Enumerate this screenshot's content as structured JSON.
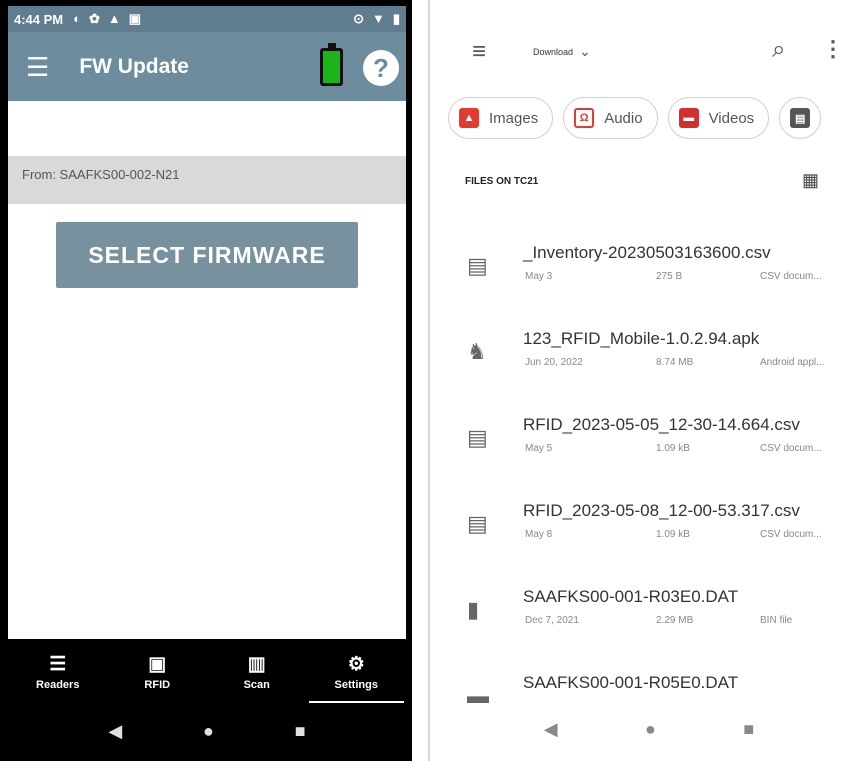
{
  "left": {
    "status": {
      "time": "4:44 PM"
    },
    "appbar": {
      "title": "FW Update"
    },
    "from_text": "From: SAAFKS00-002-N21",
    "select_button": "SELECT FIRMWARE",
    "nav": [
      {
        "label": "Readers",
        "icon": "list-icon"
      },
      {
        "label": "RFID",
        "icon": "rfid-icon"
      },
      {
        "label": "Scan",
        "icon": "barcode-icon"
      },
      {
        "label": "Settings",
        "icon": "gear-icon"
      }
    ]
  },
  "right": {
    "location": "Download",
    "chips": [
      {
        "label": "Images",
        "icon": "image-icon"
      },
      {
        "label": "Audio",
        "icon": "audio-icon"
      },
      {
        "label": "Videos",
        "icon": "video-icon"
      },
      {
        "label": "",
        "icon": "document-icon"
      }
    ],
    "section_header": "FILES ON TC21",
    "files": [
      {
        "name": "_Inventory-20230503163600.csv",
        "date": "May 3",
        "size": "275 B",
        "type": "CSV docum...",
        "icon": "document-icon"
      },
      {
        "name": "123_RFID_Mobile-1.0.2.94.apk",
        "date": "Jun 20, 2022",
        "size": "8.74 MB",
        "type": "Android appl...",
        "icon": "android-icon"
      },
      {
        "name": "RFID_2023-05-05_12-30-14.664.csv",
        "date": "May 5",
        "size": "1.09 kB",
        "type": "CSV docum...",
        "icon": "document-icon"
      },
      {
        "name": "RFID_2023-05-08_12-00-53.317.csv",
        "date": "May 8",
        "size": "1.09 kB",
        "type": "CSV docum...",
        "icon": "document-icon"
      },
      {
        "name": "SAAFKS00-001-R03E0.DAT",
        "date": "Dec 7, 2021",
        "size": "2.29 MB",
        "type": "BIN file",
        "icon": "file-icon"
      },
      {
        "name": "SAAFKS00-001-R05E0.DAT",
        "date": "",
        "size": "",
        "type": "",
        "icon": "file-icon"
      }
    ]
  },
  "colors": {
    "appbar": "#6d8c9d",
    "statusbar": "#5f7d8e",
    "battery": "#1bb51b",
    "select_button": "#78919f",
    "from_bar": "#d9d9d9",
    "chip_red": "#e33b2f"
  }
}
